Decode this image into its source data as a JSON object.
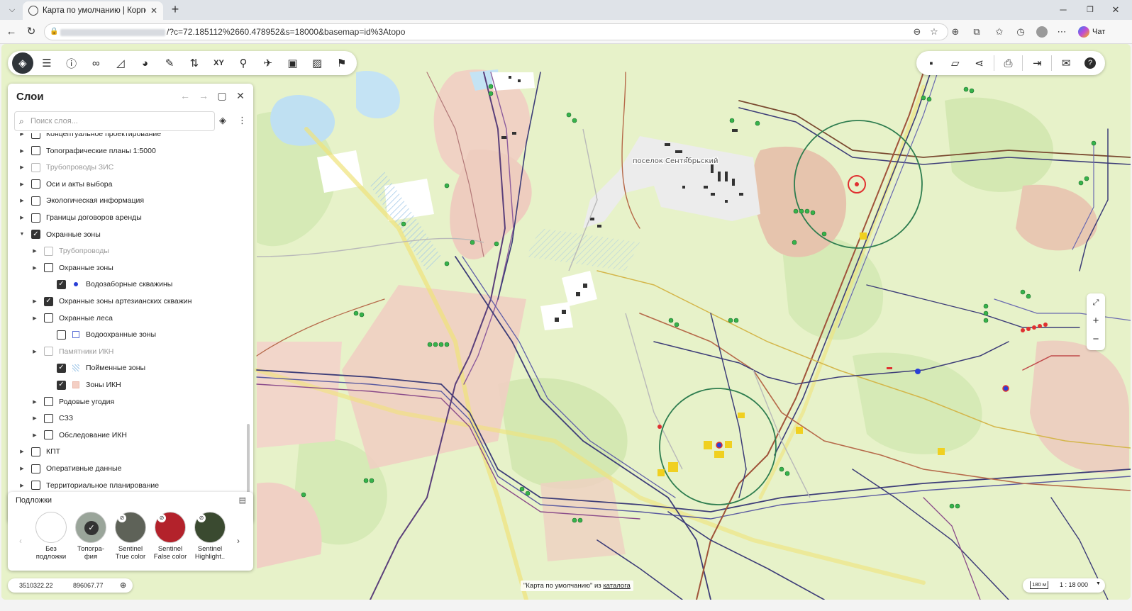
{
  "browser": {
    "tab_title": "Карта по умолчанию | Корпорати",
    "url_tail": "/?c=72.185112%2660.478952&s=18000&basemap=id%3Atopo",
    "chat_label": "Чат"
  },
  "map": {
    "label_settlement": "поселок Сентябрьский"
  },
  "toolbar_left": {
    "buttons": [
      "layers-icon",
      "list-icon",
      "info-icon",
      "binoculars-icon",
      "measure-icon",
      "palette-icon",
      "edit-icon",
      "route-icon",
      "xy-icon",
      "walker-icon",
      "plane-icon",
      "image-compare-icon",
      "image-icon",
      "flag-icon"
    ]
  },
  "toolbar_right": {
    "buttons": [
      "save-icon",
      "folder-open-icon",
      "share-icon",
      "print-icon",
      "export-icon",
      "mail-settings-icon",
      "help-icon"
    ]
  },
  "layers_panel": {
    "title": "Слои",
    "search_placeholder": "Поиск слоя...",
    "items": [
      {
        "label": "Концептуальное проектирование",
        "level": 0,
        "checked": false,
        "expanded": false,
        "disabled": false
      },
      {
        "label": "Топографические планы 1:5000",
        "level": 0,
        "checked": false,
        "expanded": false,
        "disabled": false
      },
      {
        "label": "Трубопроводы ЗИС",
        "level": 0,
        "checked": false,
        "expanded": false,
        "disabled": true
      },
      {
        "label": "Оси и акты выбора",
        "level": 0,
        "checked": false,
        "expanded": false,
        "disabled": false
      },
      {
        "label": "Экологическая информация",
        "level": 0,
        "checked": false,
        "expanded": false,
        "disabled": false
      },
      {
        "label": "Границы договоров аренды",
        "level": 0,
        "checked": false,
        "expanded": false,
        "disabled": false
      },
      {
        "label": "Охранные зоны",
        "level": 0,
        "checked": true,
        "expanded": true,
        "disabled": false
      },
      {
        "label": "Трубопроводы",
        "level": 1,
        "checked": false,
        "expanded": false,
        "disabled": true
      },
      {
        "label": "Охранные зоны",
        "level": 1,
        "checked": false,
        "expanded": false,
        "disabled": false
      },
      {
        "label": "Водозаборные скважины",
        "level": 2,
        "checked": true,
        "expanded": null,
        "disabled": false,
        "symbol": "blue-dot"
      },
      {
        "label": "Охранные зоны артезианских скважин",
        "level": 1,
        "checked": true,
        "expanded": false,
        "disabled": false
      },
      {
        "label": "Охранные леса",
        "level": 1,
        "checked": false,
        "expanded": false,
        "disabled": false
      },
      {
        "label": "Водоохранные зоны",
        "level": 2,
        "checked": false,
        "expanded": null,
        "disabled": false,
        "symbol": "blue-square"
      },
      {
        "label": "Памятники ИКН",
        "level": 1,
        "checked": false,
        "expanded": false,
        "disabled": true
      },
      {
        "label": "Пойменные зоны",
        "level": 2,
        "checked": true,
        "expanded": null,
        "disabled": false,
        "symbol": "hatch"
      },
      {
        "label": "Зоны ИКН",
        "level": 2,
        "checked": true,
        "expanded": null,
        "disabled": false,
        "symbol": "pink-square"
      },
      {
        "label": "Родовые угодия",
        "level": 1,
        "checked": false,
        "expanded": false,
        "disabled": false
      },
      {
        "label": "СЗЗ",
        "level": 1,
        "checked": false,
        "expanded": false,
        "disabled": false
      },
      {
        "label": "Обследование ИКН",
        "level": 1,
        "checked": false,
        "expanded": false,
        "disabled": false
      },
      {
        "label": "КПТ",
        "level": 0,
        "checked": false,
        "expanded": false,
        "disabled": false
      },
      {
        "label": "Оперативные данные",
        "level": 0,
        "checked": false,
        "expanded": false,
        "disabled": false
      },
      {
        "label": "Территориальное планирование",
        "level": 0,
        "checked": false,
        "expanded": false,
        "disabled": false
      }
    ]
  },
  "basemaps": {
    "title": "Подложки",
    "items": [
      {
        "line1": "Без",
        "line2": "подложки",
        "color": "#ffffff",
        "selected": false,
        "hidden": false
      },
      {
        "line1": "Топогра-",
        "line2": "фия",
        "color": "#9aa59a",
        "selected": true,
        "hidden": false
      },
      {
        "line1": "Sentinel",
        "line2": "True color",
        "color": "#5e6258",
        "selected": false,
        "hidden": true
      },
      {
        "line1": "Sentinel",
        "line2": "False color",
        "color": "#b3222b",
        "selected": false,
        "hidden": true
      },
      {
        "line1": "Sentinel",
        "line2": "Highlight..",
        "color": "#3a4a30",
        "selected": false,
        "hidden": true
      }
    ]
  },
  "status": {
    "coord_x": "3510322.22",
    "coord_y": "896067.77",
    "attribution_prefix": "\"Карта по умолчанию\" из",
    "attribution_link": "каталога",
    "scale_bar": "180 м",
    "scale_ratio": "1 : 18 000"
  }
}
